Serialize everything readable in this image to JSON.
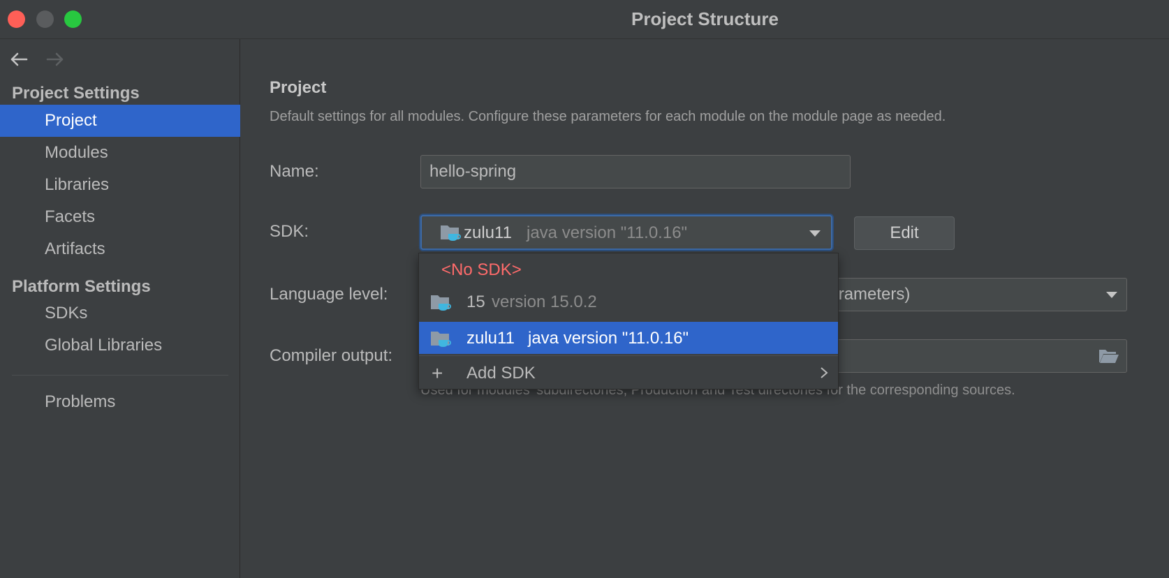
{
  "window": {
    "title": "Project Structure"
  },
  "sidebar": {
    "section_project_settings": "Project Settings",
    "section_platform_settings": "Platform Settings",
    "items": [
      {
        "label": "Project",
        "selected": true
      },
      {
        "label": "Modules"
      },
      {
        "label": "Libraries"
      },
      {
        "label": "Facets"
      },
      {
        "label": "Artifacts"
      },
      {
        "label": "SDKs"
      },
      {
        "label": "Global Libraries"
      },
      {
        "label": "Problems"
      }
    ]
  },
  "main": {
    "title": "Project",
    "description": "Default settings for all modules. Configure these parameters for each module on the module page as needed.",
    "name_label": "Name:",
    "name_value": "hello-spring",
    "sdk_label": "SDK:",
    "sdk_selected_name": "zulu11",
    "sdk_selected_version": "java version \"11.0.16\"",
    "edit_label": "Edit",
    "language_level_label": "Language level:",
    "language_level_value_visible": "a parameters)",
    "compiler_output_label": "Compiler output:",
    "compiler_hint": "Used for modules' subdirectories, Production and Test directories for the corresponding sources."
  },
  "sdk_popup": {
    "no_sdk": "<No SDK>",
    "options": [
      {
        "name": "15",
        "version": "version 15.0.2"
      },
      {
        "name": "zulu11",
        "version": "java version \"11.0.16\"",
        "selected": true
      }
    ],
    "add_sdk": "Add SDK"
  },
  "colors": {
    "background": "#3c3f41",
    "selection": "#2f65ca",
    "error_text": "#ff6b6b",
    "close_button": "#fe5f57",
    "maximize_button": "#28c840"
  },
  "icons": {
    "back": "arrow-left-icon",
    "forward": "arrow-right-icon",
    "sdk": "jdk-folder-icon",
    "dropdown": "chevron-down-icon",
    "browse": "folder-open-icon",
    "add": "plus-icon",
    "submenu": "chevron-right-icon"
  }
}
